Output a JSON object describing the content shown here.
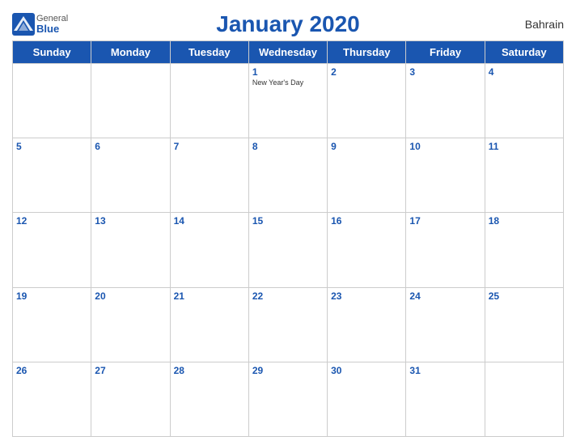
{
  "header": {
    "title": "January 2020",
    "country": "Bahrain",
    "logo": {
      "general": "General",
      "blue": "Blue"
    }
  },
  "days_of_week": [
    "Sunday",
    "Monday",
    "Tuesday",
    "Wednesday",
    "Thursday",
    "Friday",
    "Saturday"
  ],
  "weeks": [
    [
      {
        "day": "",
        "empty": true
      },
      {
        "day": "",
        "empty": true
      },
      {
        "day": "",
        "empty": true
      },
      {
        "day": "1",
        "holiday": "New Year's Day"
      },
      {
        "day": "2"
      },
      {
        "day": "3"
      },
      {
        "day": "4"
      }
    ],
    [
      {
        "day": "5"
      },
      {
        "day": "6"
      },
      {
        "day": "7"
      },
      {
        "day": "8"
      },
      {
        "day": "9"
      },
      {
        "day": "10"
      },
      {
        "day": "11"
      }
    ],
    [
      {
        "day": "12"
      },
      {
        "day": "13"
      },
      {
        "day": "14"
      },
      {
        "day": "15"
      },
      {
        "day": "16"
      },
      {
        "day": "17"
      },
      {
        "day": "18"
      }
    ],
    [
      {
        "day": "19"
      },
      {
        "day": "20"
      },
      {
        "day": "21"
      },
      {
        "day": "22"
      },
      {
        "day": "23"
      },
      {
        "day": "24"
      },
      {
        "day": "25"
      }
    ],
    [
      {
        "day": "26"
      },
      {
        "day": "27"
      },
      {
        "day": "28"
      },
      {
        "day": "29"
      },
      {
        "day": "30"
      },
      {
        "day": "31"
      },
      {
        "day": "",
        "empty": true
      }
    ]
  ]
}
